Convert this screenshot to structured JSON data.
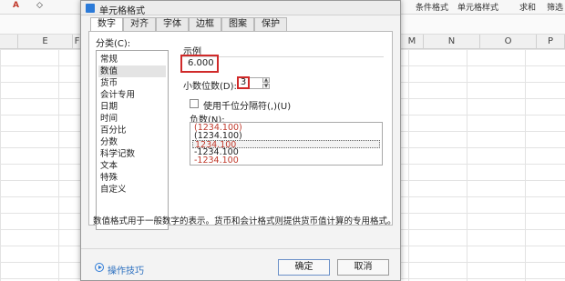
{
  "spreadsheet": {
    "ribbon": {
      "font_color_label": "A",
      "conditional_format": "条件格式",
      "cell_style": "单元格样式",
      "sum": "求和",
      "filter": "筛选"
    },
    "columns_left": [
      "E",
      "F"
    ],
    "columns_right": [
      "M",
      "N",
      "O",
      "P"
    ]
  },
  "dialog": {
    "title": "单元格格式",
    "tabs": [
      "数字",
      "对齐",
      "字体",
      "边框",
      "图案",
      "保护"
    ],
    "active_tab": "数字",
    "category_label": "分类(C):",
    "categories": [
      "常规",
      "数值",
      "货币",
      "会计专用",
      "日期",
      "时间",
      "百分比",
      "分数",
      "科学记数",
      "文本",
      "特殊",
      "自定义"
    ],
    "selected_category": "数值",
    "sample": {
      "label": "示例",
      "value": "6.000"
    },
    "decimal_places": {
      "label": "小数位数(D):",
      "value": "3"
    },
    "thousands_separator": {
      "label": "使用千位分隔符(,)(U)",
      "checked": false
    },
    "negative_numbers": {
      "label": "负数(N):",
      "items": [
        {
          "text": "(1234.100)",
          "color": "#c0392b"
        },
        {
          "text": "(1234.100)",
          "color": "#222222"
        },
        {
          "text": "1234.100",
          "color": "#c0392b"
        },
        {
          "text": "-1234.100",
          "color": "#222222"
        },
        {
          "text": "-1234.100",
          "color": "#c0392b"
        }
      ],
      "selected_index": 2
    },
    "description": "数值格式用于一般数字的表示。货币和会计格式则提供货币值计算的专用格式。",
    "tips_link": "操作技巧",
    "ok_button": "确定",
    "cancel_button": "取消",
    "colors": {
      "highlight_red": "#d02a2a",
      "link_blue": "#2b6fbf"
    }
  }
}
